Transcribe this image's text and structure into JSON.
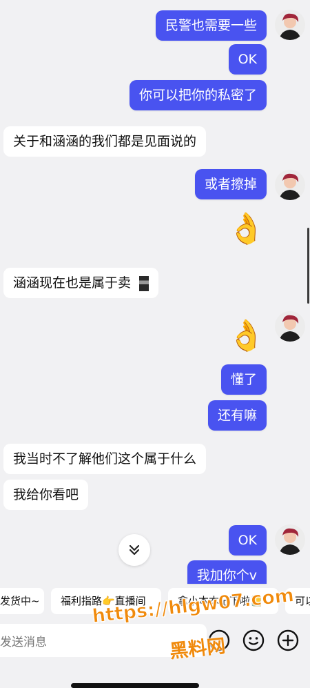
{
  "messages": [
    {
      "dir": "out",
      "text": "民警也需要一些"
    },
    {
      "dir": "out",
      "text": "OK"
    },
    {
      "dir": "out",
      "text": "你可以把你的私密了"
    },
    {
      "dir": "in",
      "text": "关于和涵涵的我们都是见面说的"
    },
    {
      "dir": "out",
      "text": "或者擦掉"
    },
    {
      "dir": "out",
      "emoji": "👌"
    },
    {
      "dir": "in",
      "text": "涵涵现在也是属于卖"
    },
    {
      "dir": "out",
      "emoji": "👌"
    },
    {
      "dir": "out",
      "text": "懂了"
    },
    {
      "dir": "out",
      "text": "还有嘛"
    },
    {
      "dir": "in",
      "text": "我当时不了解他们这个属于什么"
    },
    {
      "dir": "in",
      "text": "我给你看吧"
    },
    {
      "dir": "out",
      "text": "OK"
    },
    {
      "dir": "out",
      "text": "我加你个v"
    }
  ],
  "quick_replies": [
    "发货中~",
    "福利指路👉直播间",
    "拿小本本记下啦📒",
    "可以"
  ],
  "input": {
    "placeholder": "发送消息"
  },
  "icons": {
    "scroll_down": "chevron-double-down-icon",
    "voice": "microphone-icon",
    "emoji": "smiley-icon",
    "plus": "plus-icon"
  },
  "watermark": {
    "line1": "https://hlgw07.com",
    "line2": "黑料网"
  },
  "colors": {
    "outgoing": "#4953f0",
    "incoming": "#ffffff",
    "background": "#f1f1f3",
    "watermark": "#f08a0c"
  }
}
